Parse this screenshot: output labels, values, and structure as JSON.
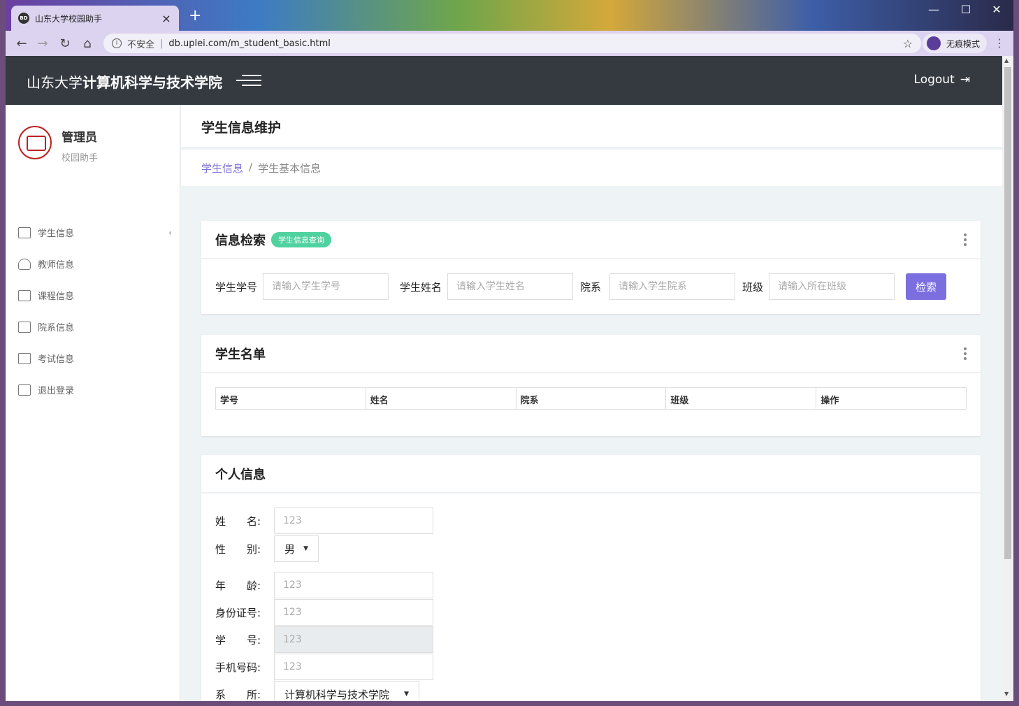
{
  "browser": {
    "tab_title": "山东大学校园助手",
    "tab_favicon": "BD",
    "insecure_label": "不安全",
    "url": "db.uplei.com/m_student_basic.html",
    "incognito_label": "无痕模式"
  },
  "topbar": {
    "brand_prefix": "山东大学",
    "brand_bold": "计算机科学与技术学院",
    "logout_label": "Logout"
  },
  "sidebar": {
    "profile_name": "管理员",
    "profile_sub": "校园助手",
    "items": [
      {
        "label": "学生信息",
        "icon": "card-icon",
        "caret": "‹"
      },
      {
        "label": "教师信息",
        "icon": "user-icon"
      },
      {
        "label": "课程信息",
        "icon": "presentation-icon"
      },
      {
        "label": "院系信息",
        "icon": "building-icon"
      },
      {
        "label": "考试信息",
        "icon": "clipboard-icon"
      },
      {
        "label": "退出登录",
        "icon": "card-icon"
      }
    ]
  },
  "page": {
    "title": "学生信息维护",
    "breadcrumb_link": "学生信息",
    "breadcrumb_sep": "/",
    "breadcrumb_current": "学生基本信息"
  },
  "search_card": {
    "title": "信息检索",
    "badge": "学生信息查询",
    "fields": [
      {
        "label": "学生学号",
        "placeholder": "请输入学生学号"
      },
      {
        "label": "学生姓名",
        "placeholder": "请输入学生姓名"
      },
      {
        "label": "院系",
        "placeholder": "请输入学生院系"
      },
      {
        "label": "班级",
        "placeholder": "请输入所在班级"
      }
    ],
    "button": "检索"
  },
  "list_card": {
    "title": "学生名单",
    "columns": [
      "学号",
      "姓名",
      "院系",
      "班级",
      "操作"
    ]
  },
  "personal_card": {
    "title": "个人信息",
    "rows": [
      {
        "label": "姓　　名:",
        "value": "123"
      },
      {
        "label": "性　　别:",
        "value": "男"
      },
      {
        "label": "年　　龄:",
        "value": "123"
      },
      {
        "label": "身份证号:",
        "value": "123"
      },
      {
        "label": "学　　号:",
        "value": "123"
      },
      {
        "label": "手机号码:",
        "value": "123"
      },
      {
        "label": "系　　所:",
        "value": "计算机科学与技术学院"
      }
    ]
  },
  "colors": {
    "accent": "#7b6fe0",
    "badge": "#4fd1a0",
    "topbar": "#343a40"
  }
}
